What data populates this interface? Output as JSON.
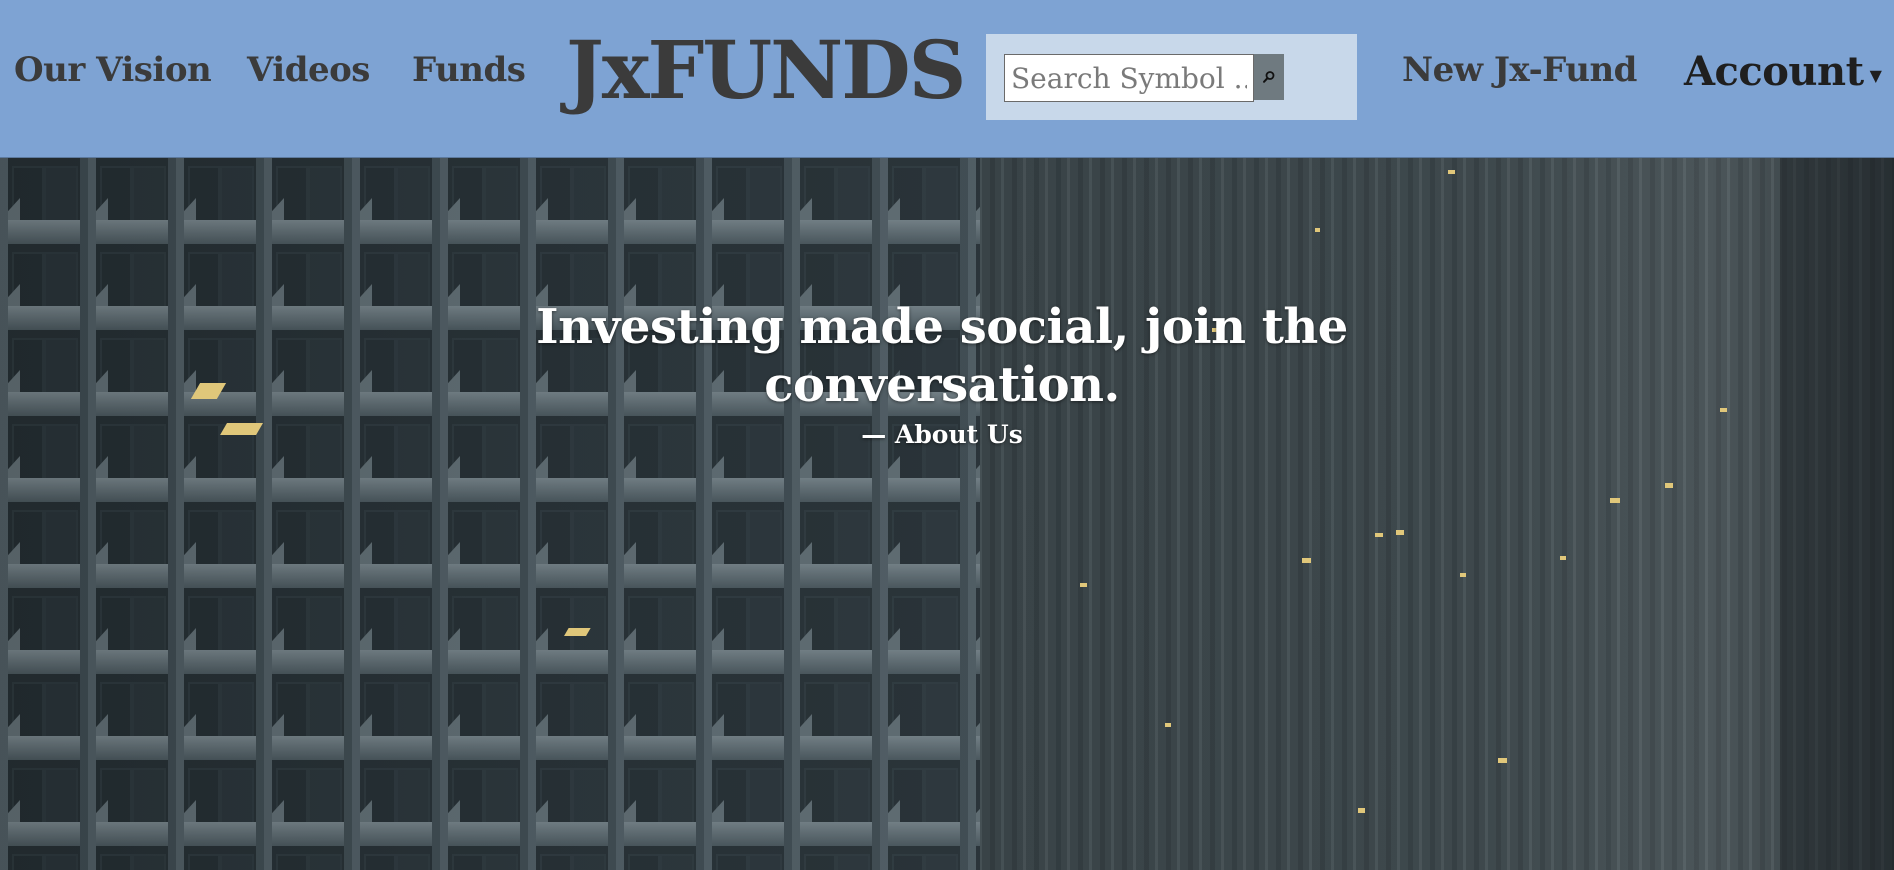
{
  "nav": {
    "links": [
      {
        "label": "Our Vision"
      },
      {
        "label": "Videos"
      },
      {
        "label": "Funds"
      }
    ],
    "brand": "JxFUNDS",
    "search": {
      "placeholder": "Search Symbol ...",
      "value": "",
      "button_icon": "search-icon"
    },
    "new_fund_label": "New Jx-Fund",
    "account_label": "Account",
    "account_caret_icon": "caret-down-icon"
  },
  "hero": {
    "quote": "Investing made social, join the conversation.",
    "attribution": "— About Us",
    "background": "office-building-facade-photo"
  },
  "colors": {
    "navbar_bg": "#7ea3d3",
    "search_panel_bg": "#c8d8ea",
    "search_button_bg": "#6f7a80",
    "nav_text": "#3b3b3b",
    "hero_text": "#ffffff"
  }
}
